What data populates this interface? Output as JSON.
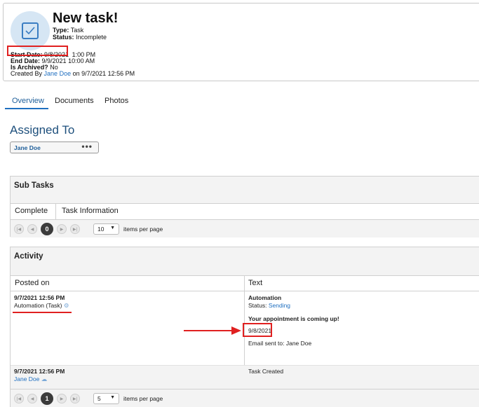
{
  "header": {
    "title": "New task!",
    "type_label": "Type:",
    "type_value": "Task",
    "status_label": "Status:",
    "status_value": "Incomplete",
    "start_label": "Start Date:",
    "start_value": "9/8/2021",
    "start_time": "1:00 PM",
    "end_label": "End Date:",
    "end_value": "9/9/2021 10:00 AM",
    "archived_label": "Is Archived?",
    "archived_value": "No",
    "created_prefix": "Created By",
    "created_by": "Jane Doe",
    "created_suffix": "on 9/7/2021 12:56 PM"
  },
  "tabs": [
    "Overview",
    "Documents",
    "Photos"
  ],
  "assigned": {
    "title": "Assigned To",
    "name": "Jane Doe",
    "more": "•••"
  },
  "subtasks": {
    "title": "Sub Tasks",
    "columns": [
      "Complete",
      "Task Information"
    ],
    "page": "0",
    "per_page": "10",
    "per_page_label": "items per page"
  },
  "activity": {
    "title": "Activity",
    "columns": [
      "Posted on",
      "Text"
    ],
    "rows": [
      {
        "posted": "9/7/2021 12:56 PM",
        "author": "Automation (Task)",
        "text_title": "Automation",
        "status_label": "Status:",
        "status_value": "Sending",
        "message": "Your appointment is coming up!",
        "date": "9/8/2021",
        "email": "Email sent to: Jane Doe"
      },
      {
        "posted": "9/7/2021 12:56 PM",
        "author": "Jane Doe",
        "text": "Task Created"
      }
    ],
    "page": "1",
    "per_page": "5",
    "per_page_label": "items per page"
  },
  "colors": {
    "accent": "#1f6fc0",
    "highlight": "#e02020"
  }
}
